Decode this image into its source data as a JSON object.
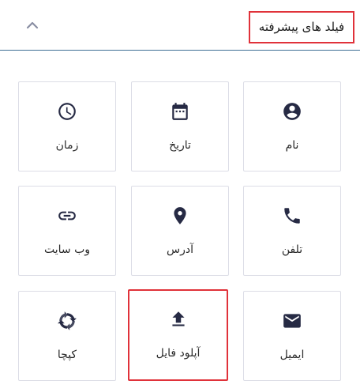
{
  "header": {
    "title": "فیلد های پیشرفته",
    "collapse_icon": "chevron-up-icon"
  },
  "colors": {
    "highlight": "#e0323a",
    "icon": "#262a44",
    "divider": "#3f6e94"
  },
  "fields": [
    {
      "label": "نام",
      "icon": "account-circle-icon"
    },
    {
      "label": "تاریخ",
      "icon": "calendar-icon"
    },
    {
      "label": "زمان",
      "icon": "clock-icon"
    },
    {
      "label": "تلفن",
      "icon": "phone-icon"
    },
    {
      "label": "آدرس",
      "icon": "location-pin-icon"
    },
    {
      "label": "وب سایت",
      "icon": "link-icon"
    },
    {
      "label": "ایمیل",
      "icon": "email-icon"
    },
    {
      "label": "آپلود فایل",
      "icon": "upload-icon"
    },
    {
      "label": "کپچا",
      "icon": "recaptcha-icon"
    }
  ]
}
